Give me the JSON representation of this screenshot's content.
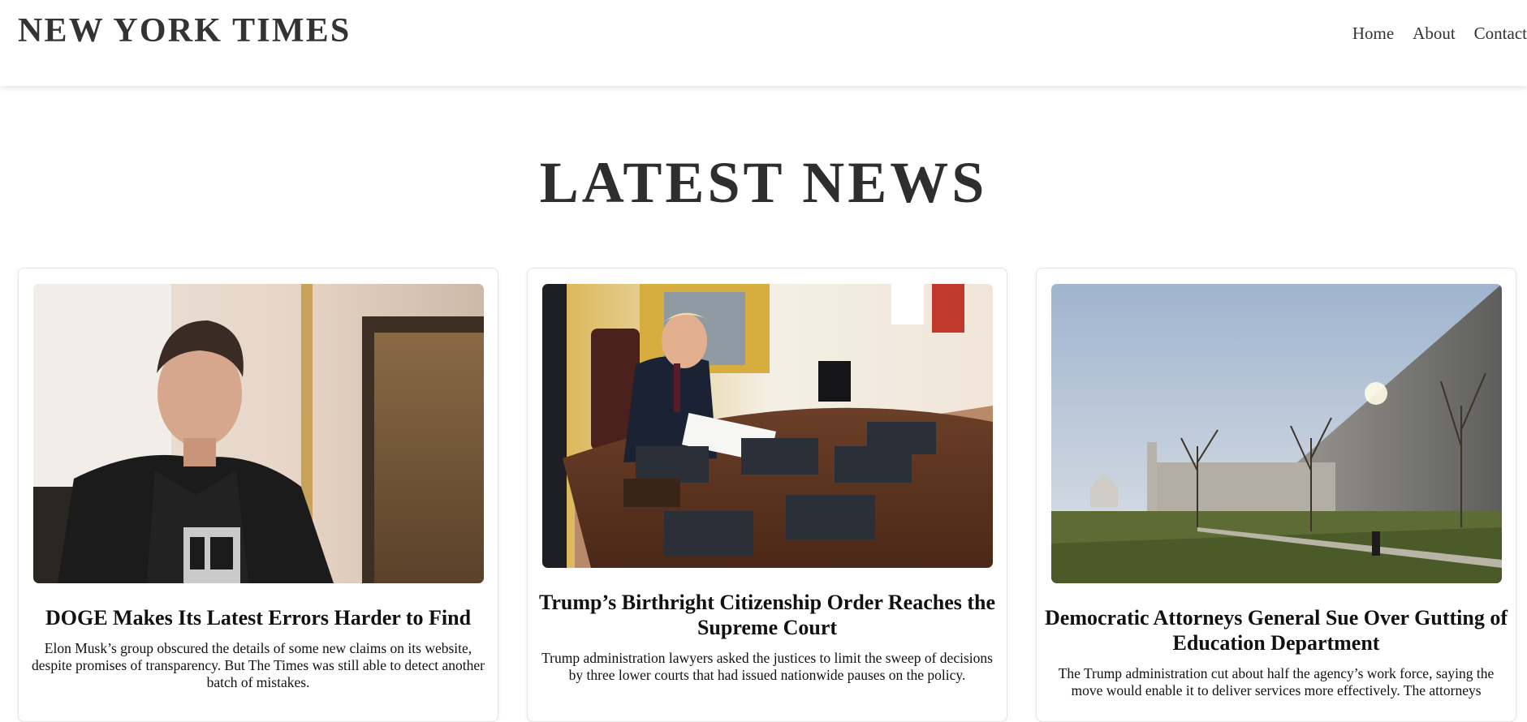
{
  "header": {
    "site_title": "NEW YORK TIMES",
    "nav": [
      {
        "label": "Home"
      },
      {
        "label": "About"
      },
      {
        "label": "Contact"
      }
    ]
  },
  "main": {
    "section_title": "LATEST NEWS",
    "articles": [
      {
        "title": "DOGE Makes Its Latest Errors Harder to Find",
        "summary": "Elon Musk’s group obscured the details of some new claims on its website, despite promises of transparency. But The Times was still able to detect another batch of mistakes.",
        "image_icon": "portrait-photo-icon"
      },
      {
        "title": "Trump’s Birthright Citizenship Order Reaches the Supreme Court",
        "summary": "Trump administration lawyers asked the justices to limit the sweep of decisions by three lower courts that had issued nationwide pauses on the policy.",
        "image_icon": "oval-office-desk-photo-icon"
      },
      {
        "title": "Democratic Attorneys General Sue Over Gutting of Education Department",
        "summary": "The Trump administration cut about half the agency’s work force, saying the move would enable it to deliver services more effectively. The attorneys",
        "image_icon": "government-building-photo-icon"
      }
    ]
  },
  "colors": {
    "title_text": "#333333",
    "card_border": "#e4e4e4",
    "background": "#ffffff"
  }
}
